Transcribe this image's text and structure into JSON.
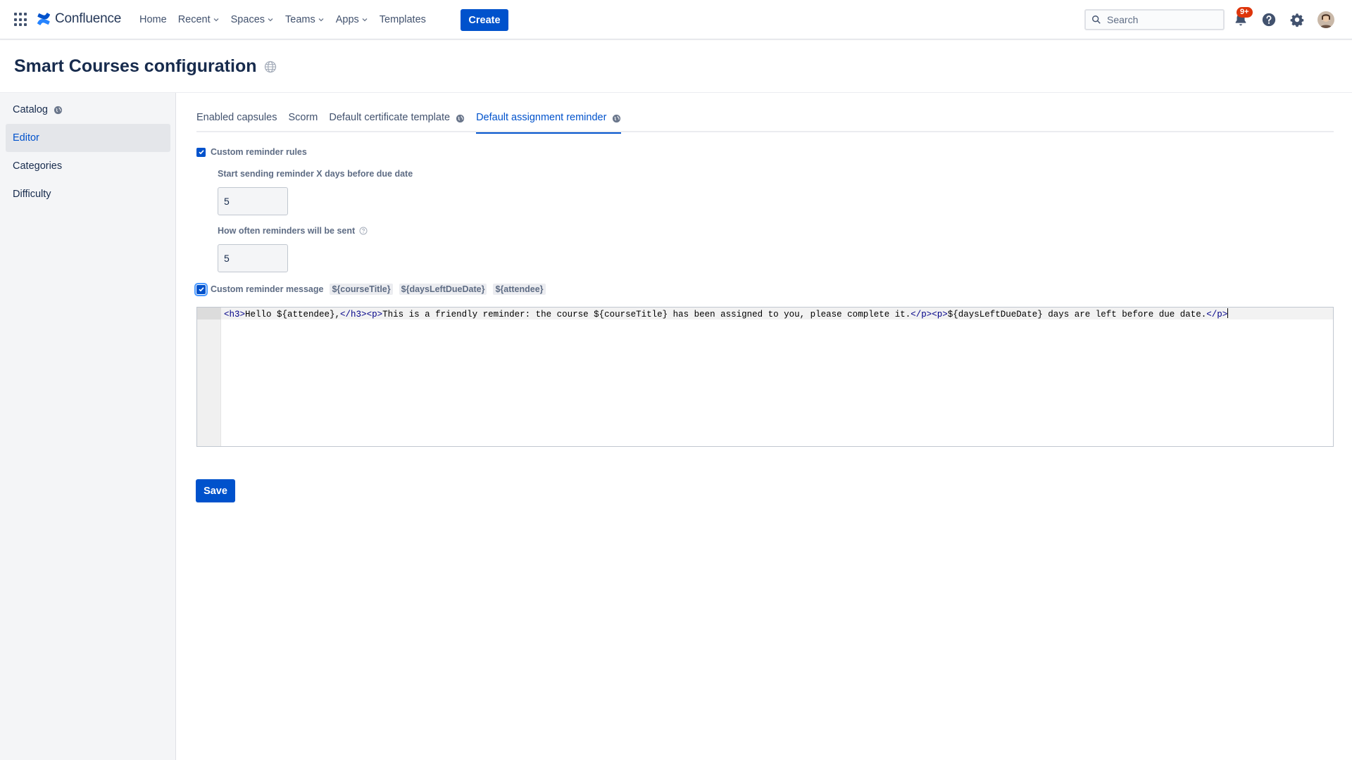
{
  "topnav": {
    "app_switcher_icon": "grid-icon",
    "logo_text": "Confluence",
    "items": [
      {
        "label": "Home",
        "dropdown": false
      },
      {
        "label": "Recent",
        "dropdown": true
      },
      {
        "label": "Spaces",
        "dropdown": true
      },
      {
        "label": "Teams",
        "dropdown": true
      },
      {
        "label": "Apps",
        "dropdown": true
      },
      {
        "label": "Templates",
        "dropdown": false
      }
    ],
    "create_label": "Create",
    "search_placeholder": "Search",
    "notifications_badge": "9+",
    "icons": [
      "notification-icon",
      "help-icon",
      "settings-icon",
      "avatar"
    ]
  },
  "page": {
    "title": "Smart Courses configuration"
  },
  "sidebar": {
    "items": [
      {
        "label": "Catalog",
        "globe": true,
        "active": false
      },
      {
        "label": "Editor",
        "globe": false,
        "active": true
      },
      {
        "label": "Categories",
        "globe": false,
        "active": false
      },
      {
        "label": "Difficulty",
        "globe": false,
        "active": false
      }
    ]
  },
  "tabs": [
    {
      "label": "Enabled capsules",
      "globe": false,
      "active": false
    },
    {
      "label": "Scorm",
      "globe": false,
      "active": false
    },
    {
      "label": "Default certificate template",
      "globe": true,
      "active": false
    },
    {
      "label": "Default assignment reminder",
      "globe": true,
      "active": true
    }
  ],
  "form": {
    "custom_rules_label": "Custom reminder rules",
    "custom_rules_checked": true,
    "start_sending_label": "Start sending reminder X days before due date",
    "start_sending_value": "5",
    "how_often_label": "How often reminders will be sent",
    "how_often_value": "5",
    "custom_message_label": "Custom reminder message",
    "custom_message_checked": true,
    "variables": [
      "${courseTitle}",
      "${daysLeftDueDate}",
      "${attendee}"
    ],
    "editor_code": [
      {
        "t": "tag",
        "v": "<h3>"
      },
      {
        "t": "text",
        "v": "Hello ${attendee},"
      },
      {
        "t": "tag",
        "v": "</h3>"
      },
      {
        "t": "tag",
        "v": "<p>"
      },
      {
        "t": "text",
        "v": "This is a friendly reminder: the course ${courseTitle} has been assigned to you, please complete it."
      },
      {
        "t": "tag",
        "v": "</p>"
      },
      {
        "t": "tag",
        "v": "<p>"
      },
      {
        "t": "text",
        "v": "${daysLeftDueDate} days are left before due date."
      },
      {
        "t": "tag",
        "v": "</p>"
      }
    ],
    "save_label": "Save"
  },
  "colors": {
    "accent": "#0052cc",
    "badge": "#de350b"
  }
}
